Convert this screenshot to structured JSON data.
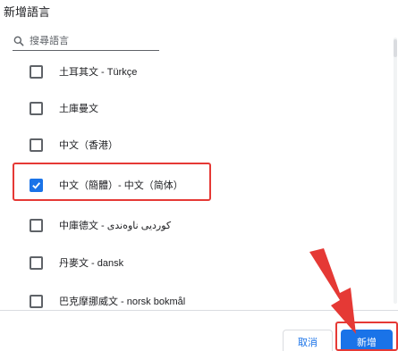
{
  "dialog": {
    "title": "新增語言"
  },
  "search": {
    "placeholder": "搜尋語言",
    "icon": "search-icon"
  },
  "languages": [
    {
      "label": "土耳其文 - Türkçe",
      "checked": false
    },
    {
      "label": "土庫曼文",
      "checked": false
    },
    {
      "label": "中文（香港）",
      "checked": false
    },
    {
      "label": "中文（簡體）- 中文（简体）",
      "checked": true
    },
    {
      "label": "中庫德文 - کوردیی ناوەندی",
      "checked": false
    },
    {
      "label": "丹麥文 - dansk",
      "checked": false
    },
    {
      "label": "巴克摩挪威文 - norsk bokmål",
      "checked": false
    }
  ],
  "buttons": {
    "cancel": "取消",
    "add": "新增"
  },
  "colors": {
    "accent": "#1a73e8",
    "annotation": "#e53935"
  }
}
